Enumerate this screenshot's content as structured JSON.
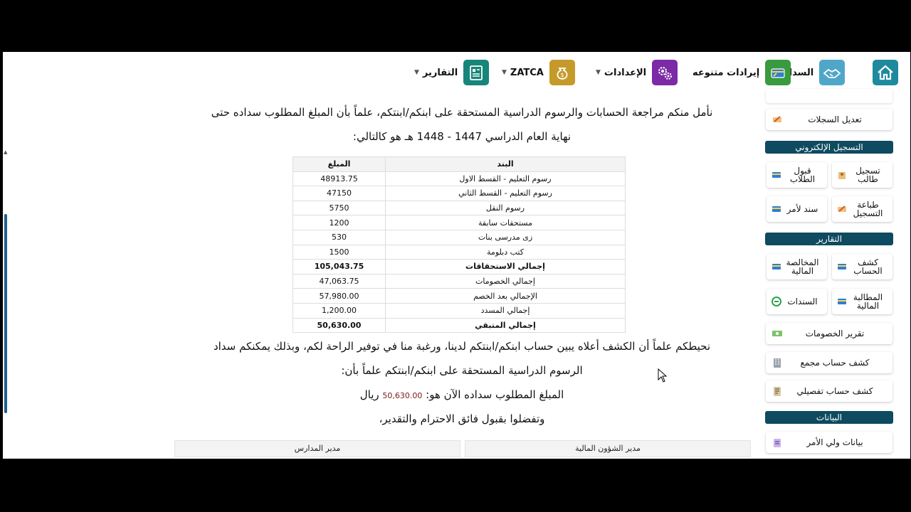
{
  "nav": {
    "home_icon": "home-icon",
    "items": [
      {
        "label": "السداد",
        "icon": "handshake-icon"
      },
      {
        "label": "إيرادات متنوعه",
        "icon": "card-icon"
      },
      {
        "label": "الإعدادات",
        "icon": "gears-icon"
      },
      {
        "label": "ZATCA",
        "icon": "money-bag-icon"
      },
      {
        "label": "التقارير",
        "icon": "report-icon"
      }
    ],
    "caret": "▼"
  },
  "letter": {
    "para1_line1": "نأمل منكم مراجعة الحسابات والرسوم الدراسية المستحقة على ابنكم/ابنتكم، علماً بأن المبلغ المطلوب سداده حتى",
    "para1_line2": "نهاية العام الدراسي 1447 - 1448 هـ  هو كالتالي:",
    "para2_line1": "نحيطكم علماً أن الكشف أعلاه يبين حساب ابنكم/ابنتكم لدينا، ورغبة منا في توفير الراحة لكم، وبذلك يمكنكم سداد",
    "para2_line2": "الرسوم الدراسية المستحقة على ابنكم/ابنتكم علماً بأن:",
    "amount_prefix": "المبلغ المطلوب سداده الآن هو:",
    "amount_value": "50,630.00",
    "amount_currency": "ريال",
    "closing": "وتفضلوا بقبول فائق الاحترام والتقدير،",
    "signatures": {
      "finance": "مدير الشؤون المالية",
      "schools": "مدير المدارس"
    }
  },
  "fee_table": {
    "headers": {
      "item": "البند",
      "amount": "المبلغ"
    },
    "rows": [
      {
        "item": "رسوم التعليم - القسط الاول",
        "amount": "48913.75"
      },
      {
        "item": "رسوم التعليم - القسط الثاني",
        "amount": "47150"
      },
      {
        "item": "رسوم النقل",
        "amount": "5750"
      },
      {
        "item": "مستحقات سابقة",
        "amount": "1200"
      },
      {
        "item": "زى مدرسى بنات",
        "amount": "530"
      },
      {
        "item": "كتب دبلومة",
        "amount": "1500"
      },
      {
        "item": "إجمالي الاستحقاقات",
        "amount": "105,043.75",
        "bold": true
      },
      {
        "item": "إجمالي الخصومات",
        "amount": "47,063.75"
      },
      {
        "item": "الإجمالي بعد الخصم",
        "amount": "57,980.00"
      },
      {
        "item": "إجمالي المسدد",
        "amount": "1,200.00"
      },
      {
        "item": "إجمالي المتبقي",
        "amount": "50,630.00",
        "bold": true
      }
    ]
  },
  "sidebar": {
    "edit_records": "تعديل السجلات",
    "section_e_registration": "التسجيل الإلكتروني",
    "register_student": "تسجيل طالب",
    "accept_students": "قبول الطلاب",
    "print_registration": "طباعة التسجيل",
    "receipt_voucher": "سند لأمر",
    "section_reports": "التقارير",
    "account_statement": "كشف الحساب",
    "financial_clearance": "المخالصة المالية",
    "financial_claim": "المطالبة المالية",
    "vouchers": "السندات",
    "discounts_report": "تقرير الخصومات",
    "aggregate_statement": "كشف حساب مجمع",
    "detailed_statement": "كشف حساب تفصيلي",
    "section_data": "البيانات",
    "guardian_data": "بيانات ولي الأمر"
  },
  "colors": {
    "header": "#0e4a60",
    "accent_teal": "#1d8a9e",
    "amount_red": "#7a1a1a"
  }
}
